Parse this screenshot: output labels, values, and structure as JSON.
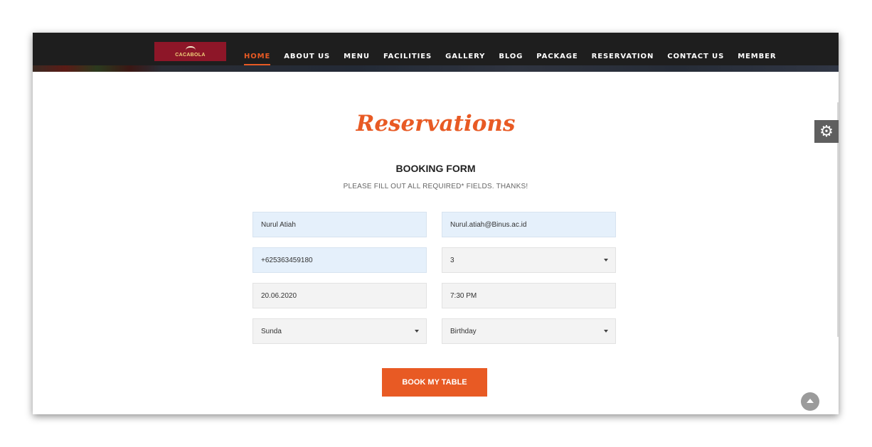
{
  "header": {
    "logo_text": "CACABOLA",
    "nav": [
      {
        "label": "HOME",
        "active": true
      },
      {
        "label": "ABOUT US"
      },
      {
        "label": "MENU"
      },
      {
        "label": "FACILITIES"
      },
      {
        "label": "GALLERY"
      },
      {
        "label": "BLOG"
      },
      {
        "label": "PACKAGE"
      },
      {
        "label": "RESERVATION"
      },
      {
        "label": "CONTACT US"
      },
      {
        "label": "MEMBER"
      }
    ]
  },
  "main": {
    "title": "Reservations",
    "form_heading": "BOOKING FORM",
    "form_subheading": "PLEASE FILL OUT ALL REQUIRED* FIELDS. THANKS!",
    "fields": {
      "name": "Nurul Atiah",
      "email": "Nurul.atiah@Binus.ac.id",
      "phone": "+625363459180",
      "guests": "3",
      "date": "20.06.2020",
      "time": "7:30 PM",
      "cuisine": "Sunda",
      "occasion": "Birthday"
    },
    "submit_label": "BOOK MY TABLE"
  },
  "colors": {
    "accent": "#e85a24",
    "navbar": "#1e1e1e",
    "logo_bg": "#8d1628",
    "autofill_bg": "#e5f0fb"
  },
  "icons": {
    "settings": "gear-icon",
    "scroll_top": "chevron-up-icon"
  }
}
